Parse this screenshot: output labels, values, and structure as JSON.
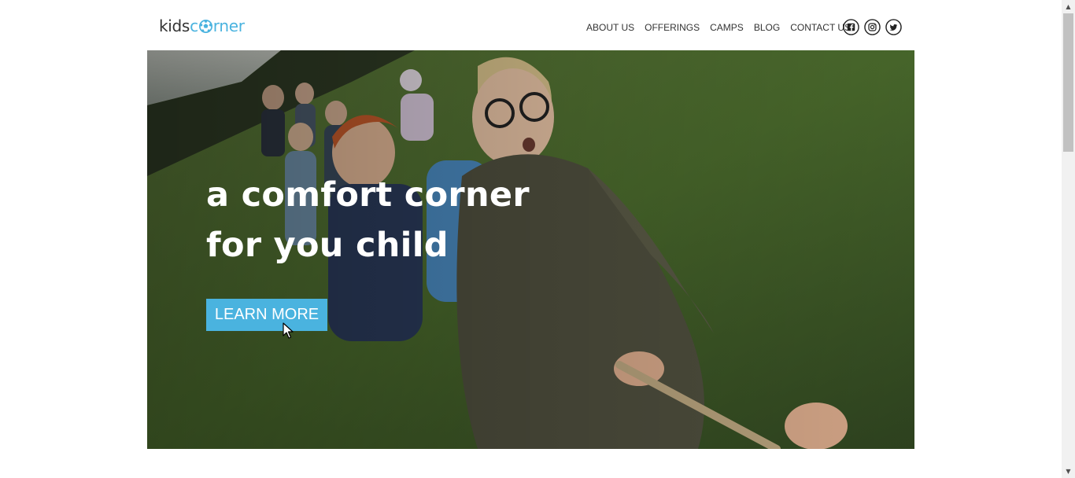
{
  "brand": {
    "logo_left": "kids",
    "logo_letter": "c",
    "logo_right": "rner",
    "primary_color": "#4ab3df",
    "text_color": "#333333"
  },
  "nav": {
    "items": [
      {
        "label": "ABOUT US"
      },
      {
        "label": "OFFERINGS"
      },
      {
        "label": "CAMPS"
      },
      {
        "label": "BLOG"
      },
      {
        "label": "CONTACT US"
      }
    ]
  },
  "social": {
    "icons": [
      "facebook-icon",
      "instagram-icon",
      "twitter-icon"
    ]
  },
  "hero": {
    "title_line1": "a comfort corner",
    "title_line2": "for you child",
    "cta_label": "LEARN MORE",
    "image_icon": "children-tug-of-war-photo"
  }
}
